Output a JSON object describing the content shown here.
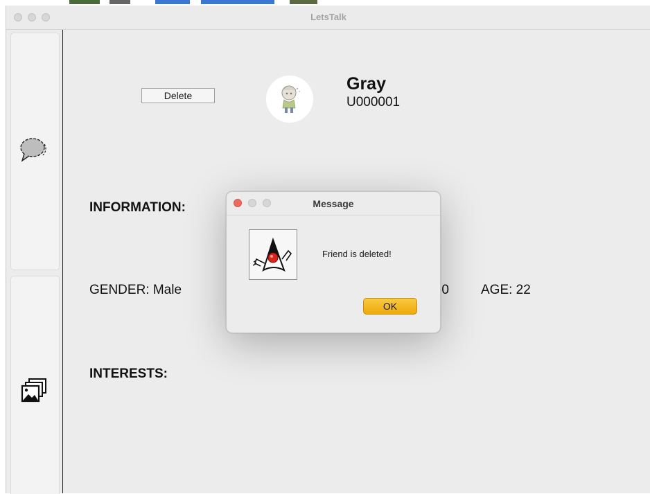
{
  "window": {
    "title": "LetsTalk"
  },
  "sidebar": {
    "items": [
      {
        "icon": "chat-bubble-icon"
      },
      {
        "icon": "image-gallery-icon"
      }
    ]
  },
  "profile": {
    "delete_label": "Delete",
    "name": "Gray",
    "user_id": "U000001",
    "information_heading": "INFORMATION:",
    "gender_text": "GENDER: Male",
    "birthday_fragment": ")0",
    "age_text": "AGE: 22",
    "interests_heading": "INTERESTS:"
  },
  "dialog": {
    "title": "Message",
    "message": "Friend is deleted!",
    "ok_label": "OK",
    "icon": "java-duke-icon"
  },
  "colors": {
    "accent_ok": "#f2b51f",
    "close_light": "#ed6a5e",
    "inactive_light": "#d6d6d6",
    "window_bg": "#ececec"
  }
}
